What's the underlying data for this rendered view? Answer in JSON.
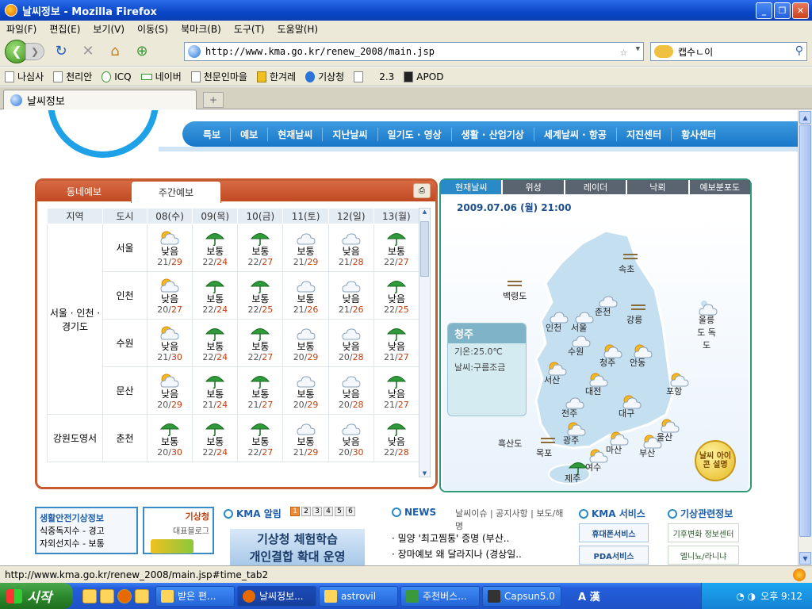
{
  "window": {
    "title": "날씨정보 - Mozilla Firefox"
  },
  "menu": [
    "파일(F)",
    "편집(E)",
    "보기(V)",
    "이동(S)",
    "북마크(B)",
    "도구(T)",
    "도움말(H)"
  ],
  "address": {
    "url": "http://www.kma.go.kr/renew_2008/main.jsp"
  },
  "search": {
    "value": "캡수ㄴ이"
  },
  "bookmarks": [
    "나심사",
    "천리안",
    "ICQ",
    "네이버",
    "천문인마을",
    "한겨레",
    "기상청",
    "2.3",
    "APOD"
  ],
  "tab": {
    "label": "날씨정보"
  },
  "main_nav": [
    "특보",
    "예보",
    "현재날씨",
    "지난날씨",
    "일기도 · 영상",
    "생활 · 산업기상",
    "세계날씨 · 항공",
    "지진센터",
    "황사센터"
  ],
  "forecast": {
    "tab_local": "동네예보",
    "tab_weekly": "주간예보",
    "columns": [
      "지역",
      "도시",
      "08(수)",
      "09(목)",
      "10(금)",
      "11(토)",
      "12(일)",
      "13(월)"
    ],
    "groups": [
      {
        "region": "서울 · 인천 · 경기도",
        "cities": [
          {
            "name": "서울",
            "days": [
              {
                "icon": "partly-cloudy",
                "label": "낮음",
                "lo": "21",
                "hi": "29"
              },
              {
                "icon": "umbrella",
                "label": "보통",
                "lo": "22",
                "hi": "24"
              },
              {
                "icon": "umbrella",
                "label": "보통",
                "lo": "22",
                "hi": "27"
              },
              {
                "icon": "cloud",
                "label": "보통",
                "lo": "21",
                "hi": "29"
              },
              {
                "icon": "cloud",
                "label": "낮음",
                "lo": "21",
                "hi": "28"
              },
              {
                "icon": "umbrella",
                "label": "보통",
                "lo": "22",
                "hi": "27"
              }
            ]
          },
          {
            "name": "인천",
            "days": [
              {
                "icon": "partly-cloudy",
                "label": "낮음",
                "lo": "20",
                "hi": "27"
              },
              {
                "icon": "umbrella",
                "label": "보통",
                "lo": "22",
                "hi": "24"
              },
              {
                "icon": "umbrella",
                "label": "보통",
                "lo": "22",
                "hi": "25"
              },
              {
                "icon": "cloud",
                "label": "보통",
                "lo": "21",
                "hi": "26"
              },
              {
                "icon": "cloud",
                "label": "낮음",
                "lo": "21",
                "hi": "26"
              },
              {
                "icon": "umbrella",
                "label": "낮음",
                "lo": "22",
                "hi": "25"
              }
            ]
          },
          {
            "name": "수원",
            "days": [
              {
                "icon": "partly-cloudy",
                "label": "낮음",
                "lo": "21",
                "hi": "30"
              },
              {
                "icon": "umbrella",
                "label": "보통",
                "lo": "22",
                "hi": "24"
              },
              {
                "icon": "umbrella",
                "label": "보통",
                "lo": "22",
                "hi": "27"
              },
              {
                "icon": "cloud",
                "label": "보통",
                "lo": "20",
                "hi": "29"
              },
              {
                "icon": "cloud",
                "label": "낮음",
                "lo": "20",
                "hi": "28"
              },
              {
                "icon": "umbrella",
                "label": "낮음",
                "lo": "21",
                "hi": "27"
              }
            ]
          },
          {
            "name": "문산",
            "days": [
              {
                "icon": "partly-cloudy",
                "label": "낮음",
                "lo": "20",
                "hi": "29"
              },
              {
                "icon": "umbrella",
                "label": "보통",
                "lo": "21",
                "hi": "24"
              },
              {
                "icon": "umbrella",
                "label": "보통",
                "lo": "21",
                "hi": "27"
              },
              {
                "icon": "cloud",
                "label": "보통",
                "lo": "20",
                "hi": "29"
              },
              {
                "icon": "cloud",
                "label": "낮음",
                "lo": "20",
                "hi": "28"
              },
              {
                "icon": "umbrella",
                "label": "낮음",
                "lo": "21",
                "hi": "27"
              }
            ]
          }
        ]
      },
      {
        "region": "강원도영서",
        "cities": [
          {
            "name": "춘천",
            "days": [
              {
                "icon": "umbrella",
                "label": "보통",
                "lo": "20",
                "hi": "30"
              },
              {
                "icon": "umbrella",
                "label": "보통",
                "lo": "22",
                "hi": "24"
              },
              {
                "icon": "umbrella",
                "label": "보통",
                "lo": "22",
                "hi": "27"
              },
              {
                "icon": "cloud",
                "label": "보통",
                "lo": "21",
                "hi": "29"
              },
              {
                "icon": "cloud",
                "label": "낮음",
                "lo": "20",
                "hi": "30"
              },
              {
                "icon": "umbrella",
                "label": "낮음",
                "lo": "22",
                "hi": "28"
              }
            ]
          }
        ]
      }
    ]
  },
  "map": {
    "tabs": [
      "현재날씨",
      "위성",
      "레이더",
      "낙뢰",
      "예보분포도"
    ],
    "datetime": "2009.07.06 (월) 21:00",
    "info": {
      "city": "청주",
      "temp": "기온:25.0℃",
      "sky": "날씨:구름조금"
    },
    "cities": [
      {
        "name": "속초",
        "icon": "haze"
      },
      {
        "name": "백령도",
        "icon": "haze"
      },
      {
        "name": "춘천",
        "icon": "cloud"
      },
      {
        "name": "강릉",
        "icon": "haze"
      },
      {
        "name": "울릉도 독도",
        "icon": "cloud"
      },
      {
        "name": "인천",
        "icon": "cloud"
      },
      {
        "name": "서울",
        "icon": "cloud"
      },
      {
        "name": "수원",
        "icon": "cloud"
      },
      {
        "name": "청주",
        "icon": "partly-cloudy"
      },
      {
        "name": "안동",
        "icon": "partly-cloudy"
      },
      {
        "name": "서산",
        "icon": "partly-cloudy"
      },
      {
        "name": "대전",
        "icon": "partly-cloudy"
      },
      {
        "name": "포항",
        "icon": "partly-cloudy"
      },
      {
        "name": "전주",
        "icon": "cloud"
      },
      {
        "name": "대구",
        "icon": "partly-cloudy"
      },
      {
        "name": "울산",
        "icon": "partly-cloudy"
      },
      {
        "name": "흑산도",
        "icon": "none"
      },
      {
        "name": "광주",
        "icon": "partly-cloudy"
      },
      {
        "name": "목포",
        "icon": "haze"
      },
      {
        "name": "마산",
        "icon": "partly-cloudy"
      },
      {
        "name": "부산",
        "icon": "partly-cloudy"
      },
      {
        "name": "여수",
        "icon": "partly-cloudy"
      },
      {
        "name": "제주",
        "icon": "umbrella"
      }
    ],
    "icon_legend": "날씨 아이콘 설명"
  },
  "bottom": {
    "safety": {
      "title": "생활안전기상정보",
      "line1": "식중독지수 - 경고",
      "line2": "자외선지수 - 보통"
    },
    "blog": {
      "title": "기상청",
      "sub": "대표블로그"
    },
    "kma_notice": {
      "title": "KMA 알림",
      "pages": [
        "1",
        "2",
        "3",
        "4",
        "5",
        "6"
      ],
      "banner1": "기상청 체험학습",
      "banner2": "개인결합 확대 운영"
    },
    "news": {
      "title": "NEWS",
      "tabs": "날씨이슈 | 공지사항 | 보도/해명",
      "items": [
        "밀양 '최고찜통' 증명 (부산..",
        "장마예보 왜 달라지나 (경상일.."
      ]
    },
    "service": {
      "title": "KMA 서비스",
      "items": [
        "휴대폰서비스",
        "PDA서비스"
      ]
    },
    "related": {
      "title": "기상관련정보",
      "items": [
        "기후변화 정보센터",
        "엘니뇨/라니냐"
      ]
    }
  },
  "status": {
    "text": "http://www.kma.go.kr/renew_2008/main.jsp#time_tab2"
  },
  "taskbar": {
    "start": "시작",
    "buttons": [
      "받은 편...",
      "날씨정보...",
      "astrovil",
      "주천버스...",
      "Capsun5.0"
    ],
    "clock": "오후 9:12"
  }
}
